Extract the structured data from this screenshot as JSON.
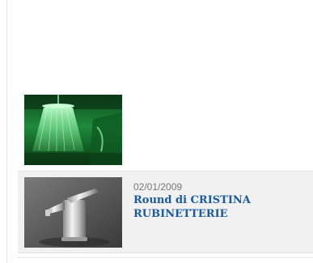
{
  "items": [
    {
      "image": "shower-head-green-image"
    },
    {
      "image": "faucet-image",
      "date": "02/01/2009",
      "title": "Round di CRISTINA RUBINETTERIE"
    }
  ],
  "colors": {
    "title_link": "#1a5aa0",
    "date_text": "#777777",
    "highlight_bg": "#f1f1f1"
  }
}
